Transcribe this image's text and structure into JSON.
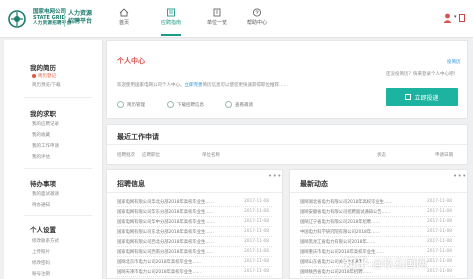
{
  "header": {
    "brand_line1": "国家电网公司",
    "brand_line2": "STATE GRID",
    "brand_line3": "人力资源招聘平台",
    "brand_title": "人力资源",
    "brand_subtitle": "招聘平台",
    "nav": [
      {
        "label": "首页",
        "icon": "home-icon"
      },
      {
        "label": "应聘指南",
        "icon": "book-icon"
      },
      {
        "label": "单位一览",
        "icon": "building-icon"
      },
      {
        "label": "帮助中心",
        "icon": "help-icon"
      }
    ],
    "active_nav": 1
  },
  "sidebar": {
    "sections": [
      {
        "title": "我的简历",
        "items": [
          "简历登记",
          "简历预览/下载"
        ]
      },
      {
        "title": "我的求职",
        "items": [
          "我的应聘记录",
          "我的收藏",
          "我的工作申请",
          "我的评估"
        ]
      },
      {
        "title": "待办事项",
        "items": [
          "我的面试邀请",
          "待办通知"
        ]
      },
      {
        "title": "个人设置",
        "items": [
          "修改联系方式",
          "上传照片",
          "修改密码",
          "账号注销"
        ]
      }
    ]
  },
  "personal_center": {
    "title": "个人中心",
    "hint_prefix": "欢迎使用国家电网公司个人中心。",
    "hint_link": "立即完善",
    "hint_suffix": "简历信息可以使您更快速获得职位推荐……",
    "features": [
      "简历管理",
      "下载招聘信息",
      "查看邀请"
    ],
    "shortcut_hint": "还没投简历？快来登录个人中心吧！",
    "shortcut_link": "投简历",
    "apply_button": "立即投递"
  },
  "applications": {
    "title": "最近工作申请",
    "columns": [
      "招聘批次",
      "应聘职位",
      "单位名称",
      "状态",
      "申请日期"
    ]
  },
  "recruitment": {
    "title": "招聘信息",
    "more": "•••",
    "items": [
      {
        "text": "国家电网有限公司华北分部2018年高校毕业生……",
        "date": "2017-11-08"
      },
      {
        "text": "国家电网有限公司华东分部2018年高校毕业生……",
        "date": "2017-11-08"
      },
      {
        "text": "国家电网有限公司华中分部2018年高校毕业生……",
        "date": "2017-11-08"
      },
      {
        "text": "国家电网有限公司东北分部2018年高校毕业生……",
        "date": "2017-11-08"
      },
      {
        "text": "国家电网有限公司西北分部2018年高校毕业生……",
        "date": "2017-11-08"
      },
      {
        "text": "国家电网有限公司西南分部2018年高校毕业生……",
        "date": "2017-11-08"
      },
      {
        "text": "国网北京市电力公司2018年高校毕业生……",
        "date": "2017-11-08"
      },
      {
        "text": "国网天津市电力公司2018年高校毕业生……",
        "date": "2017-11-08"
      }
    ]
  },
  "news": {
    "title": "最新动态",
    "more": "•••",
    "items": [
      {
        "text": "国网湖北省电力有限公司2018年高校毕业生……",
        "date": "2017-11-08"
      },
      {
        "text": "国网安徽省电力有限公司招聘面试通知公告……",
        "date": "2017-11-08"
      },
      {
        "text": "国网辽宁省电力有限公司2018年招聘……",
        "date": "2017-11-08"
      },
      {
        "text": "中国电力科学研究院有限公司2018年……",
        "date": "2017-11-08"
      },
      {
        "text": "国网黑龙江省电力有限公司2018年……",
        "date": "2017-11-08"
      },
      {
        "text": "国网重庆市电力公司2018年高校毕业生……",
        "date": "2017-11-08"
      },
      {
        "text": "国网山东省电力公司关于2018年……",
        "date": "2017-11-08"
      },
      {
        "text": "国网陕西省电力公司2018年招聘……",
        "date": "2017-11-08"
      }
    ]
  },
  "watermark": {
    "site": "知乎",
    "author": "@玖石国网"
  }
}
